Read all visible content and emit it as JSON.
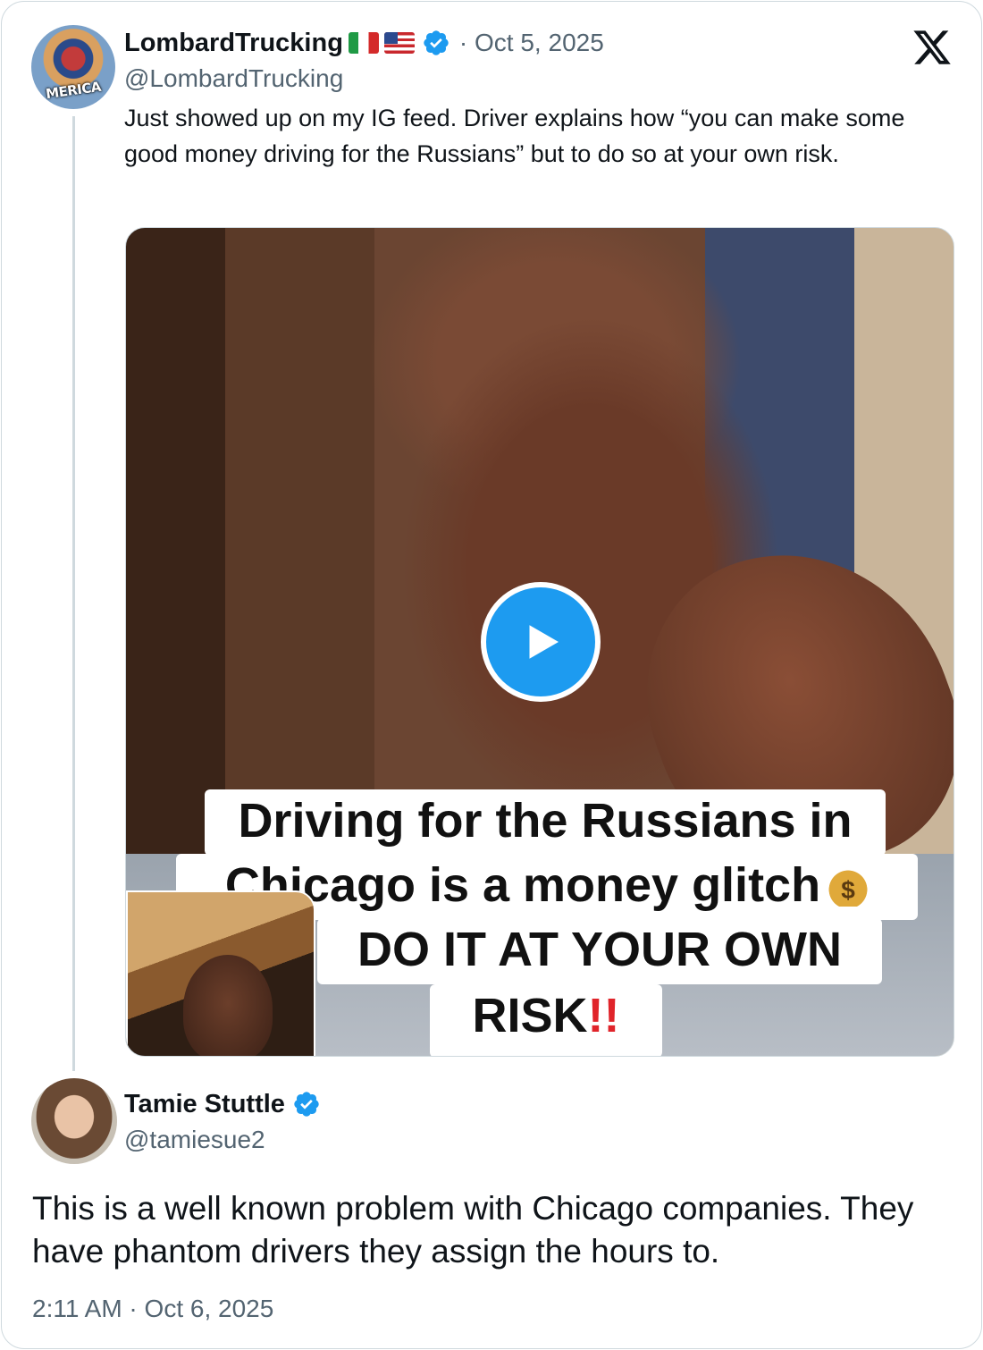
{
  "parent_tweet": {
    "avatar_text": "MERICA",
    "display_name": "LombardTrucking",
    "flags": [
      "italy-flag",
      "us-flag"
    ],
    "verified": true,
    "date": "· Oct 5, 2025",
    "handle": "@LombardTrucking",
    "text": "Just showed up on my IG feed. Driver explains how “you can make some good money driving for the Russians” but to do so at your own risk.",
    "media": {
      "type": "video",
      "caption_line1": "Driving for the Russians in",
      "caption_line2": "Chicago is a money glitch",
      "caption_line2_emoji": "$",
      "caption_line3": "DO IT AT YOUR OWN",
      "caption_line4": "RISK",
      "caption_line4_emoji": "!!"
    }
  },
  "reply_tweet": {
    "display_name": "Tamie Stuttle",
    "verified": true,
    "handle": "@tamiesue2",
    "text": "This is a well known problem with Chicago companies. They have phantom drivers they assign the hours to.",
    "timestamp": "2:11 AM · Oct 6, 2025"
  },
  "colors": {
    "verified_blue": "#1d9bf0",
    "secondary_text": "#536471",
    "primary_text": "#0f1419",
    "border": "#cfd9de"
  },
  "icons": {
    "platform_logo": "x-logo-icon",
    "verified": "verified-badge-icon",
    "play": "play-icon"
  }
}
